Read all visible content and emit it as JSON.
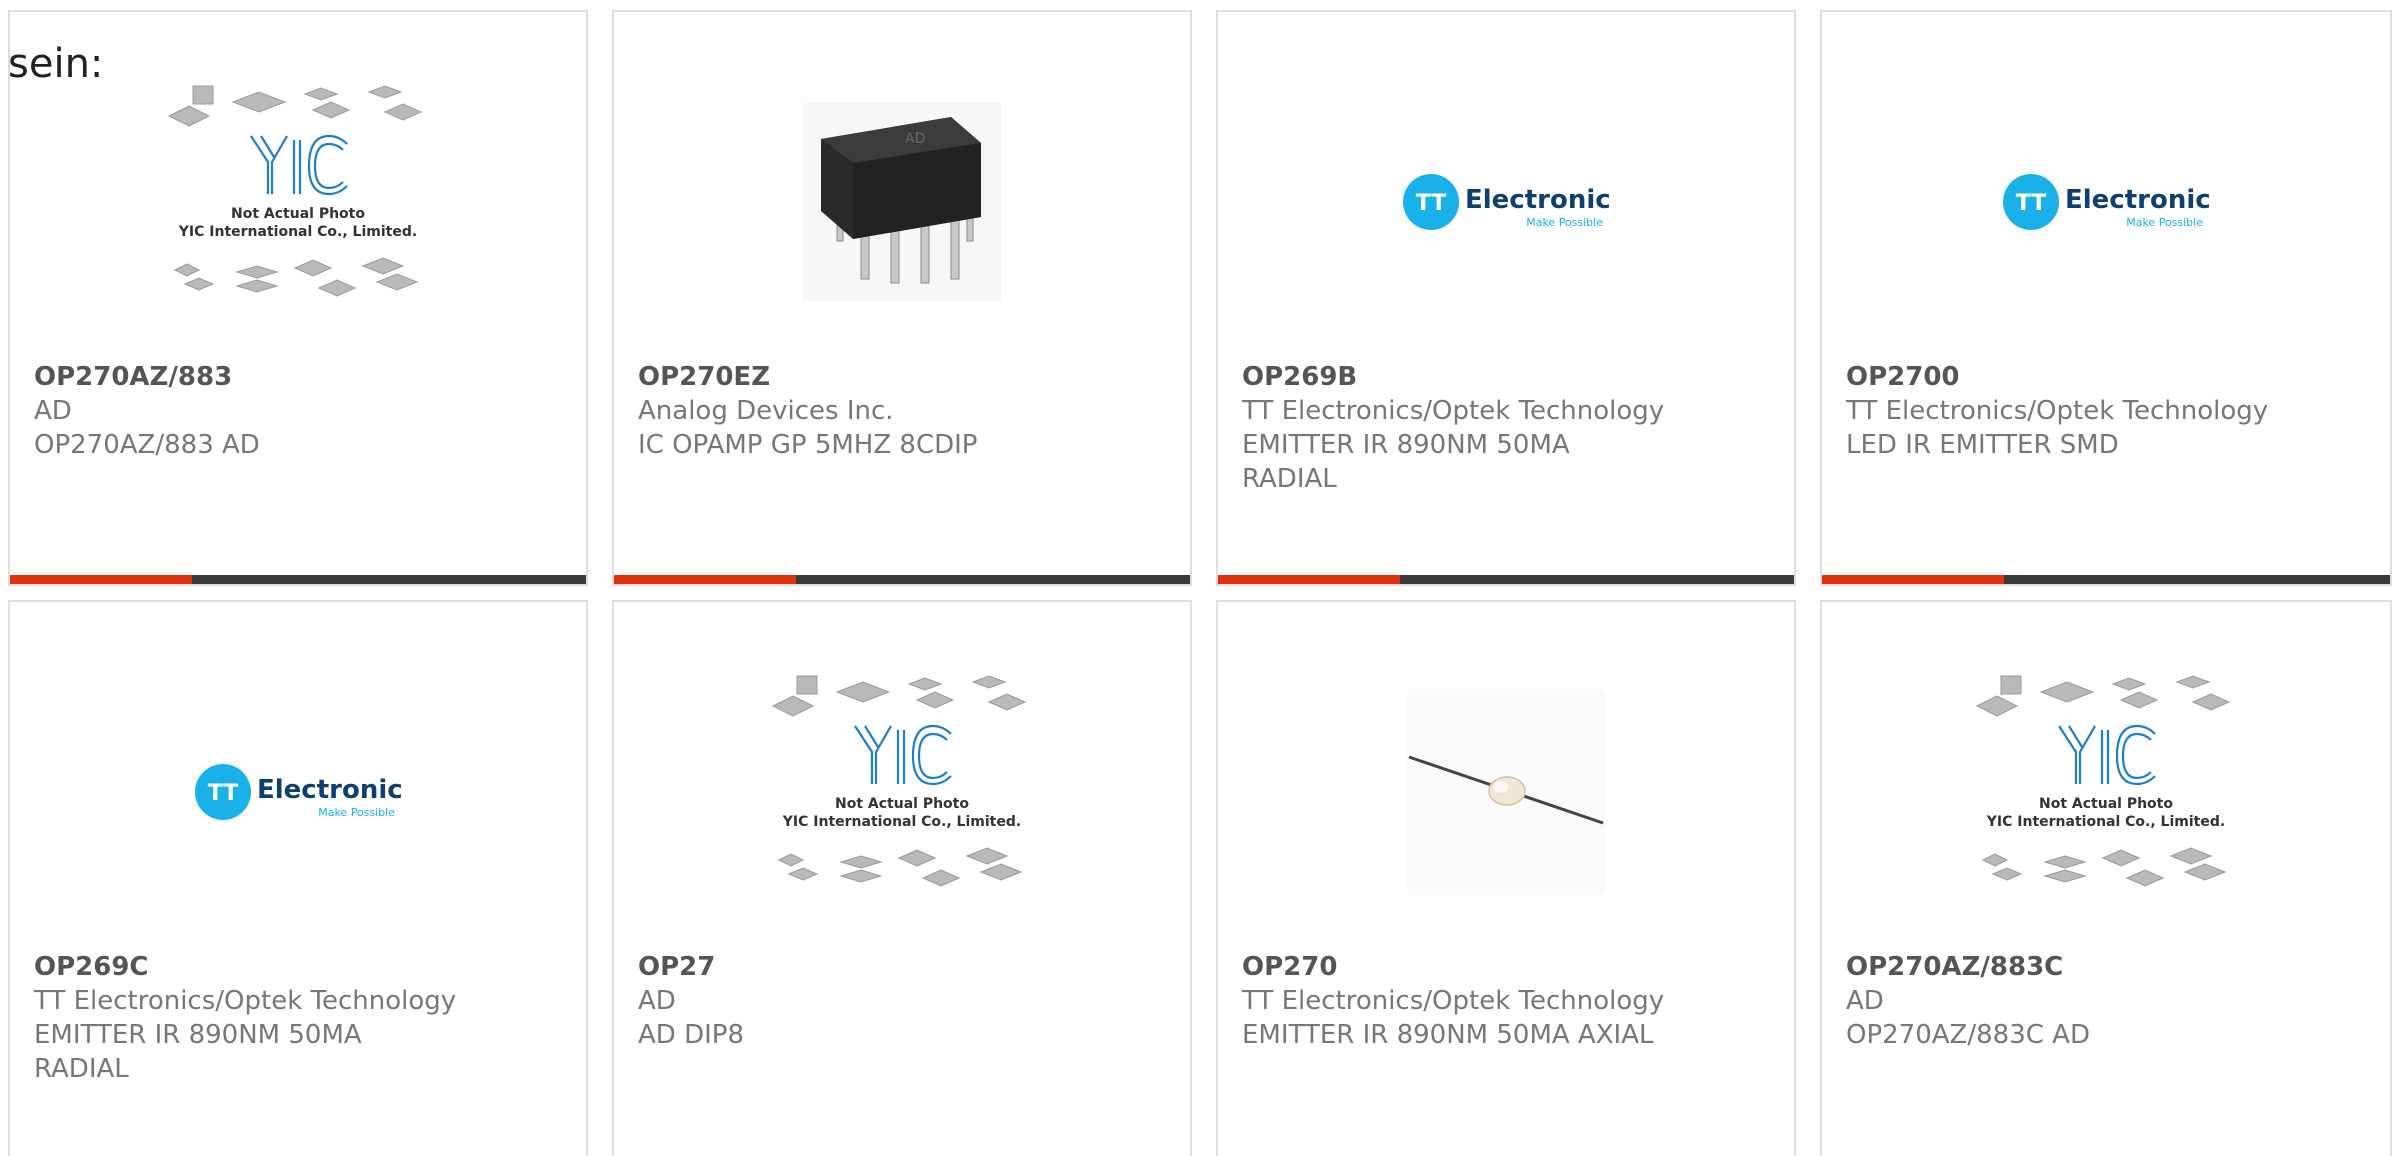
{
  "intro": {
    "text": "sein:"
  },
  "placeholder": {
    "logo_text": "YIC",
    "caption_line1": "Not Actual Photo",
    "caption_line2": "YIC International Co., Limited."
  },
  "tt_logo": {
    "mark": "TT",
    "name": "Electronics",
    "tagline": "Make Possible"
  },
  "chip_marking": "AD",
  "colors": {
    "accent": "#e0310f",
    "bar": "#3a3a3a",
    "tt_blue": "#1ab0e8",
    "yic_blue": "#1e7fc8"
  },
  "products": [
    {
      "part": "OP270AZ/883",
      "maker": "AD",
      "desc": [
        "OP270AZ/883 AD"
      ],
      "image": "placeholder"
    },
    {
      "part": "OP270EZ",
      "maker": "Analog Devices Inc.",
      "desc": [
        "IC OPAMP GP 5MHZ 8CDIP"
      ],
      "image": "dip-chip"
    },
    {
      "part": "OP269B",
      "maker": "TT Electronics/Optek Technology",
      "desc": [
        "EMITTER IR 890NM 50MA",
        "RADIAL"
      ],
      "image": "tt-logo"
    },
    {
      "part": "OP2700",
      "maker": "TT Electronics/Optek Technology",
      "desc": [
        "LED IR EMITTER SMD"
      ],
      "image": "tt-logo"
    },
    {
      "part": "OP269C",
      "maker": "TT Electronics/Optek Technology",
      "desc": [
        "EMITTER IR 890NM 50MA",
        "RADIAL"
      ],
      "image": "tt-logo"
    },
    {
      "part": "OP27",
      "maker": "AD",
      "desc": [
        "AD DIP8"
      ],
      "image": "placeholder"
    },
    {
      "part": "OP270",
      "maker": "TT Electronics/Optek Technology",
      "desc": [
        "EMITTER IR 890NM 50MA AXIAL"
      ],
      "image": "axial-emitter"
    },
    {
      "part": "OP270AZ/883C",
      "maker": "AD",
      "desc": [
        "OP270AZ/883C AD"
      ],
      "image": "placeholder"
    }
  ]
}
